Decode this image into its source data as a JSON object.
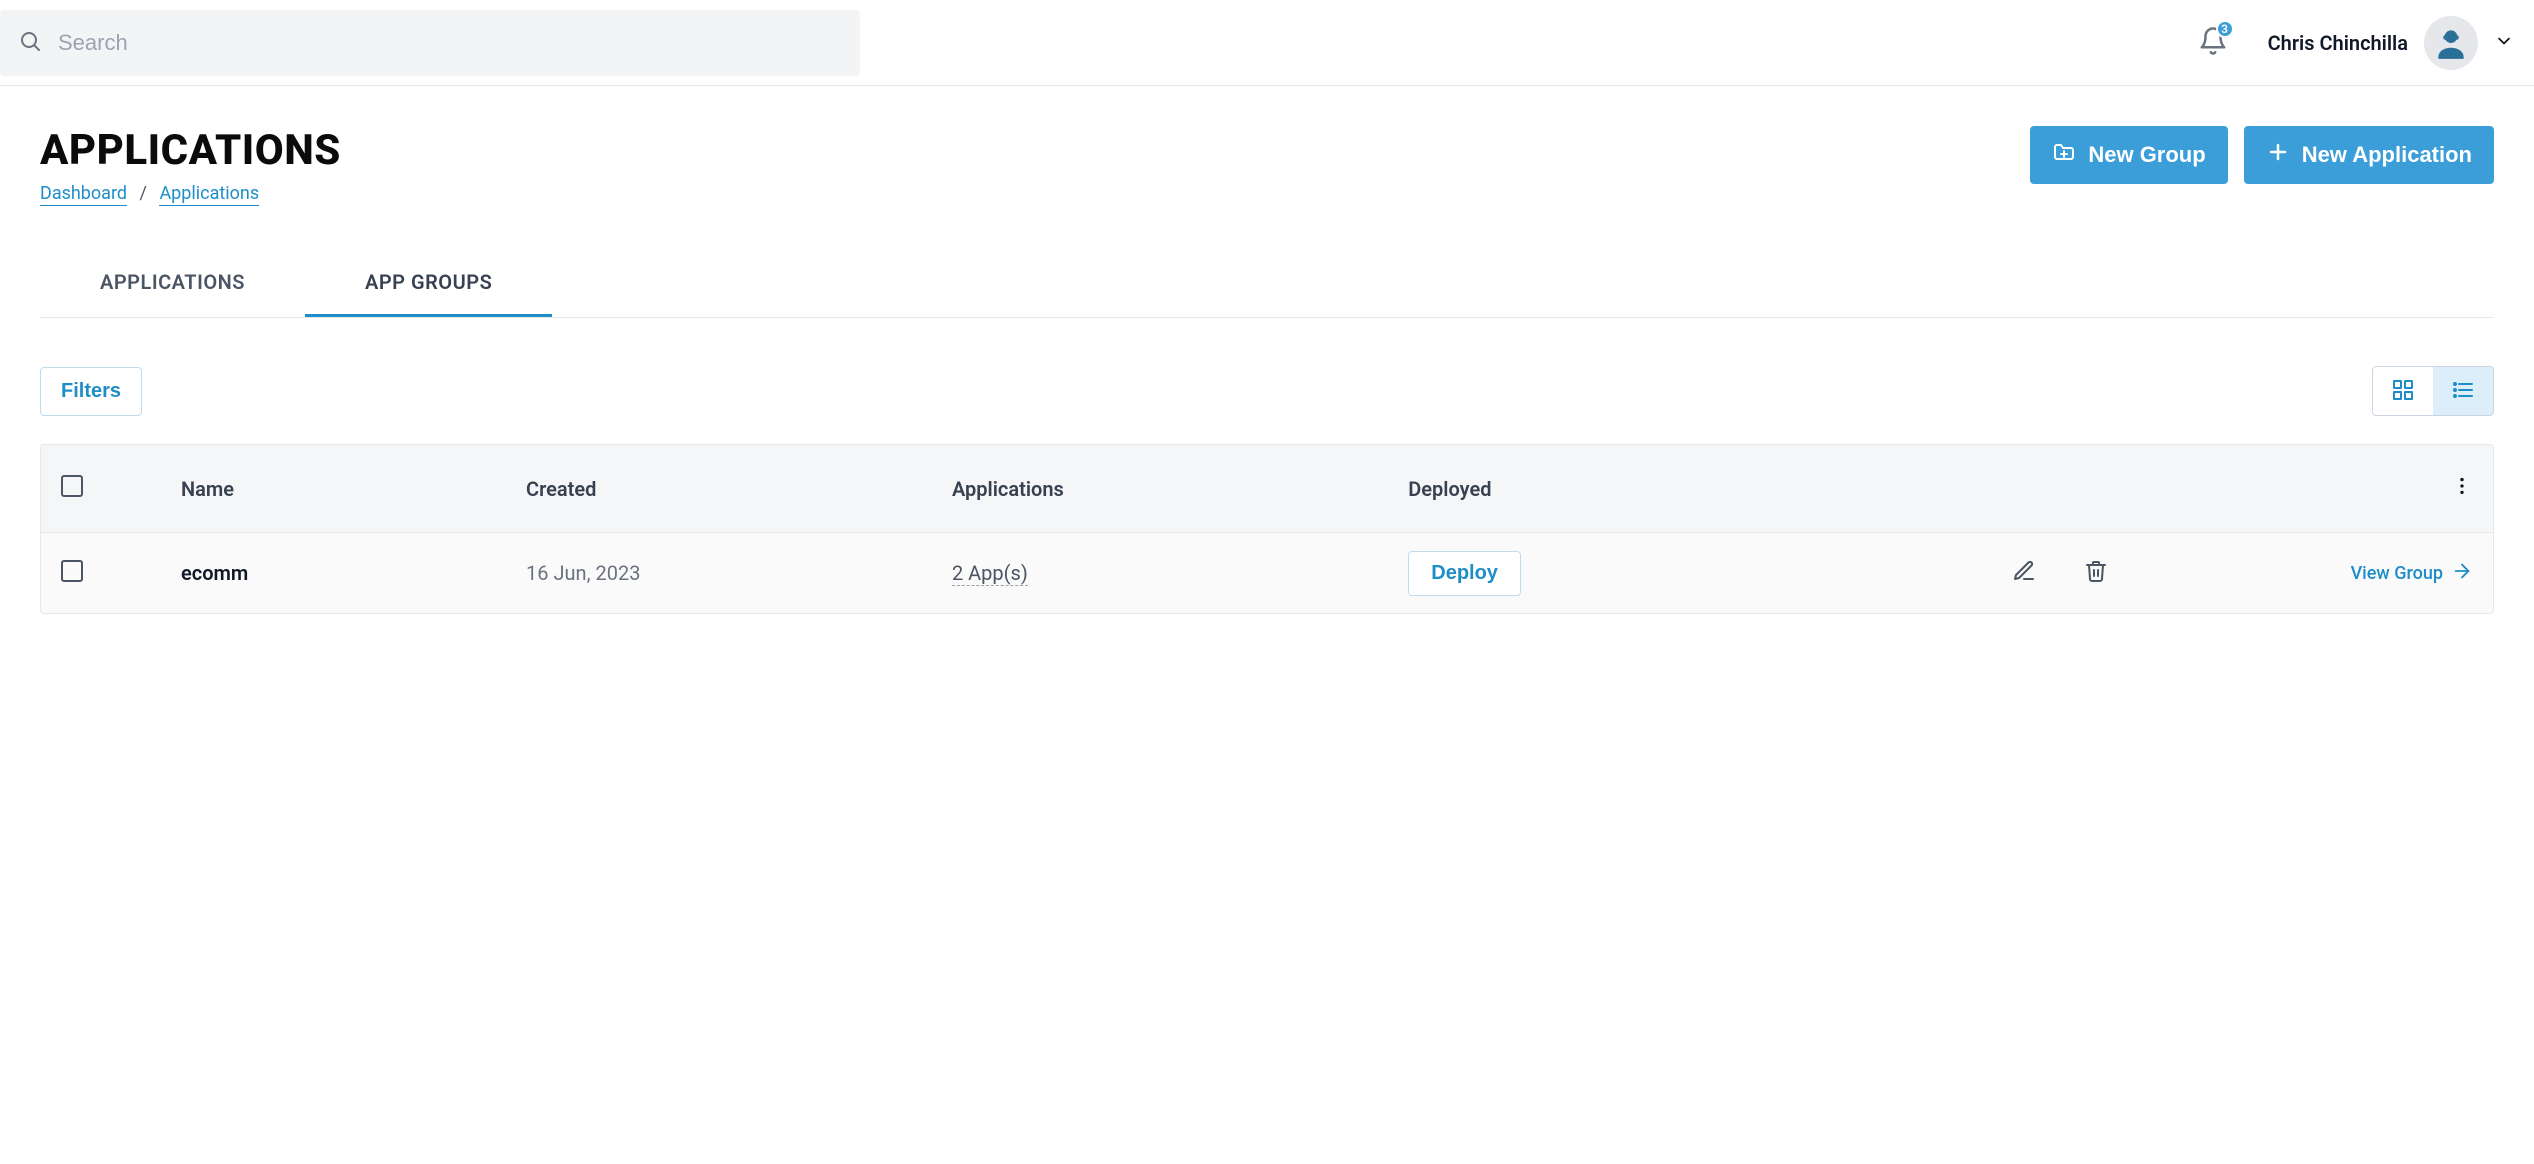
{
  "header": {
    "search_placeholder": "Search",
    "notification_count": "3",
    "user_name": "Chris Chinchilla"
  },
  "page": {
    "title": "APPLICATIONS",
    "breadcrumb": {
      "root": "Dashboard",
      "current": "Applications",
      "separator": "/"
    },
    "actions": {
      "new_group": "New Group",
      "new_application": "New Application"
    }
  },
  "tabs": {
    "applications": "APPLICATIONS",
    "app_groups": "APP GROUPS"
  },
  "filters": {
    "button_label": "Filters"
  },
  "table": {
    "columns": {
      "name": "Name",
      "created": "Created",
      "applications": "Applications",
      "deployed": "Deployed"
    },
    "rows": [
      {
        "name": "ecomm",
        "created": "16 Jun, 2023",
        "applications": "2 App(s)",
        "deploy_label": "Deploy",
        "view_label": "View Group"
      }
    ]
  }
}
